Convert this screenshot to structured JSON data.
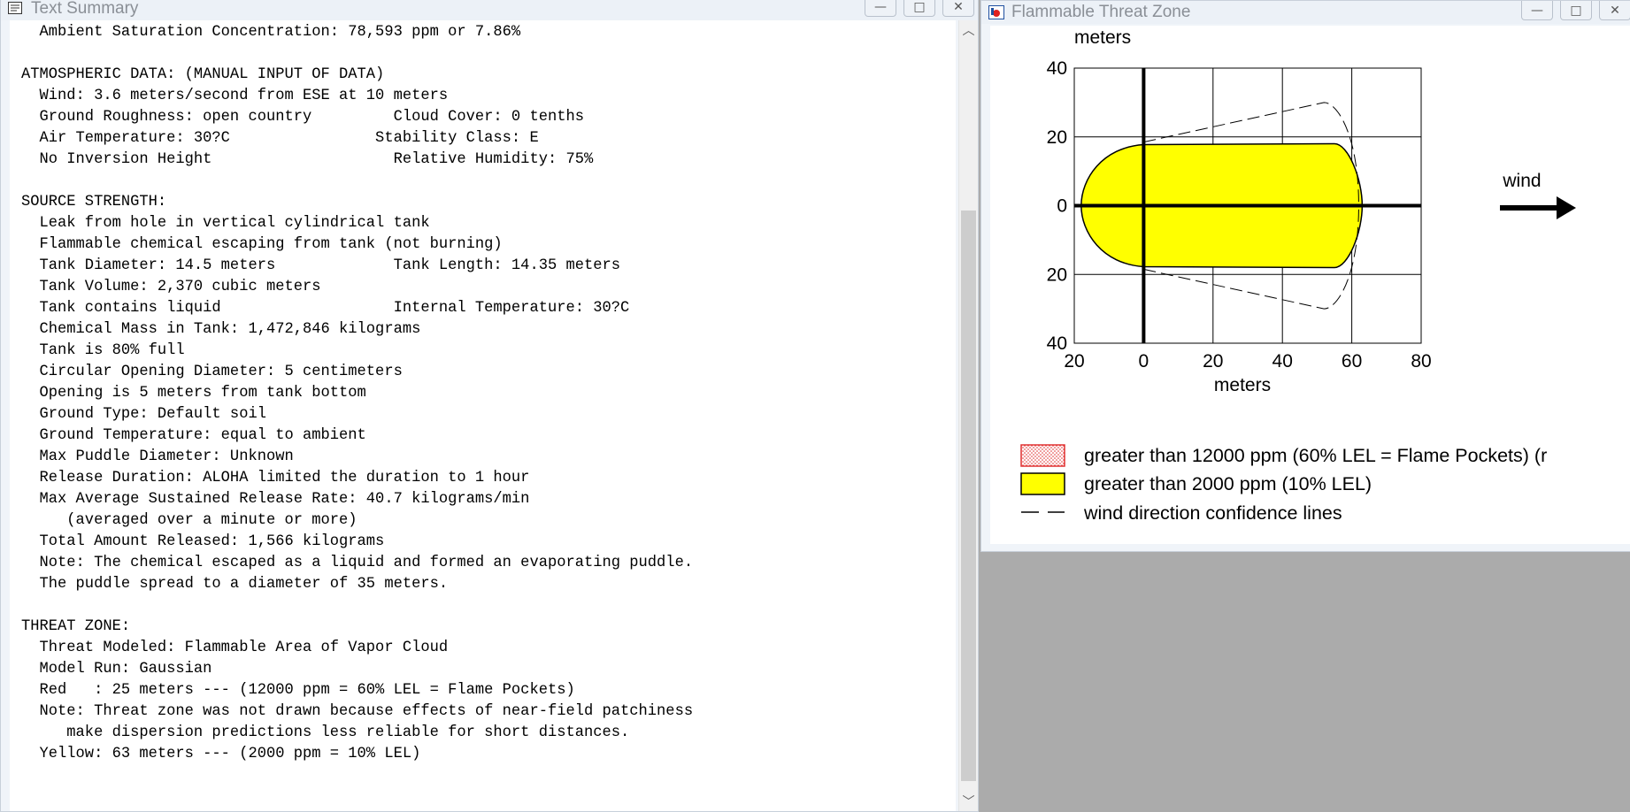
{
  "text_window": {
    "title": "Text Summary",
    "lines": [
      "  Ambient Saturation Concentration: 78,593 ppm or 7.86%",
      "",
      "ATMOSPHERIC DATA: (MANUAL INPUT OF DATA)",
      "  Wind: 3.6 meters/second from ESE at 10 meters",
      "  Ground Roughness: open country         Cloud Cover: 0 tenths",
      "  Air Temperature: 30?C                Stability Class: E",
      "  No Inversion Height                    Relative Humidity: 75%",
      "",
      "SOURCE STRENGTH:",
      "  Leak from hole in vertical cylindrical tank",
      "  Flammable chemical escaping from tank (not burning)",
      "  Tank Diameter: 14.5 meters             Tank Length: 14.35 meters",
      "  Tank Volume: 2,370 cubic meters",
      "  Tank contains liquid                   Internal Temperature: 30?C",
      "  Chemical Mass in Tank: 1,472,846 kilograms",
      "  Tank is 80% full",
      "  Circular Opening Diameter: 5 centimeters",
      "  Opening is 5 meters from tank bottom",
      "  Ground Type: Default soil",
      "  Ground Temperature: equal to ambient",
      "  Max Puddle Diameter: Unknown",
      "  Release Duration: ALOHA limited the duration to 1 hour",
      "  Max Average Sustained Release Rate: 40.7 kilograms/min",
      "     (averaged over a minute or more)",
      "  Total Amount Released: 1,566 kilograms",
      "  Note: The chemical escaped as a liquid and formed an evaporating puddle.",
      "  The puddle spread to a diameter of 35 meters.",
      "",
      "THREAT ZONE:",
      "  Threat Modeled: Flammable Area of Vapor Cloud",
      "  Model Run: Gaussian",
      "  Red   : 25 meters --- (12000 ppm = 60% LEL = Flame Pockets)",
      "  Note: Threat zone was not drawn because effects of near-field patchiness",
      "     make dispersion predictions less reliable for short distances.",
      "  Yellow: 63 meters --- (2000 ppm = 10% LEL)"
    ]
  },
  "chart_window": {
    "title": "Flammable Threat Zone",
    "wind_label": "wind",
    "legend": [
      {
        "label": "greater than 12000 ppm (60% LEL = Flame Pockets) (r",
        "swatch": "red-dotted"
      },
      {
        "label": "greater than 2000 ppm (10% LEL)",
        "swatch": "yellow"
      },
      {
        "label": "wind direction confidence lines",
        "swatch": "dashed"
      }
    ]
  },
  "window_buttons": {
    "minimize": "—",
    "maximize": "□",
    "close": "✕"
  },
  "colors": {
    "yellow_zone": "#ffff00",
    "red_zone": "#ff0000",
    "desktop": "#ababab"
  },
  "chart_data": {
    "type": "area",
    "ylabel": "meters",
    "xlabel": "meters",
    "x_ticks": [
      "20",
      "0",
      "20",
      "40",
      "60",
      "80"
    ],
    "y_ticks": [
      "40",
      "20",
      "0",
      "20",
      "40"
    ],
    "xlim": [
      -20,
      80
    ],
    "ylim": [
      -40,
      40
    ],
    "grid": true,
    "series": [
      {
        "name": "greater than 2000 ppm (10% LEL)",
        "color": "#ffff00",
        "downwind_extent": 63,
        "max_half_width": 18
      }
    ],
    "confidence_lines": {
      "max_downwind": 62,
      "max_half_width": 30
    }
  }
}
